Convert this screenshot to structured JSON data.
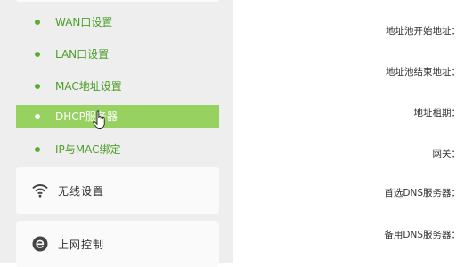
{
  "sidebar": {
    "sub_items": [
      {
        "label": "WAN口设置"
      },
      {
        "label": "LAN口设置"
      },
      {
        "label": "MAC地址设置"
      },
      {
        "label": "DHCP服务器"
      },
      {
        "label": "IP与MAC绑定"
      }
    ],
    "sections": [
      {
        "label": "无线设置",
        "icon": "wifi-icon"
      },
      {
        "label": "上网控制",
        "icon": "e-circle-icon"
      }
    ]
  },
  "form": {
    "labels": [
      "地址池开始地址：",
      "地址池结束地址：",
      "地址租期：",
      "网关：",
      "首选DNS服务器：",
      "备用DNS服务器："
    ]
  },
  "colors": {
    "accent_green": "#97d260",
    "text_green": "#4d9f2b"
  }
}
